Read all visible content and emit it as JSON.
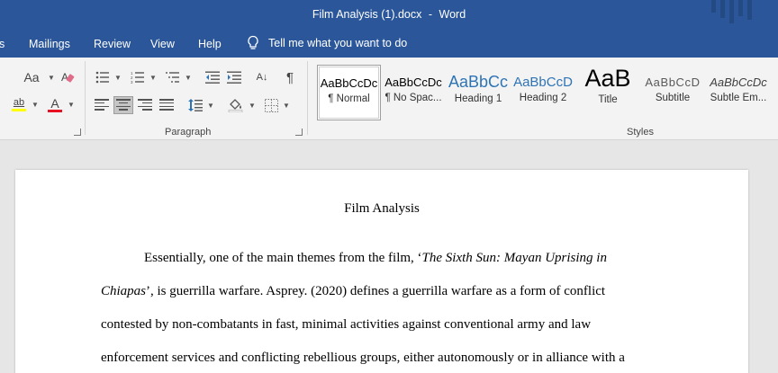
{
  "window": {
    "file_name": "Film Analysis (1).docx",
    "separator": "-",
    "app_name": "Word"
  },
  "menu": {
    "tabs": [
      "s",
      "Mailings",
      "Review",
      "View",
      "Help"
    ],
    "tell_me": "Tell me what you want to do"
  },
  "ribbon": {
    "font_group": {
      "font_size_glyph": "Aa",
      "highlight_glyph": "ab",
      "font_color_glyph": "A",
      "highlight_color": "#ffff00",
      "font_color": "#e81123"
    },
    "paragraph_group": {
      "label": "Paragraph",
      "sort_glyph": "A↓",
      "pilcrow_glyph": "¶"
    },
    "styles_group": {
      "label": "Styles",
      "items": [
        {
          "sample": "AaBbCcDc",
          "name": "¶ Normal"
        },
        {
          "sample": "AaBbCcDc",
          "name": "¶ No Spac..."
        },
        {
          "sample": "AaBbCc",
          "name": "Heading 1"
        },
        {
          "sample": "AaBbCcD",
          "name": "Heading 2"
        },
        {
          "sample": "AaB",
          "name": "Title"
        },
        {
          "sample": "AaBbCcD",
          "name": "Subtitle"
        },
        {
          "sample": "AaBbCcDc",
          "name": "Subtle Em..."
        }
      ]
    }
  },
  "document": {
    "title": "Film Analysis",
    "paragraph": {
      "line1_before": "Essentially, one of the main themes from the film, ‘",
      "line1_italic": "The Sixth Sun: Mayan Uprising in",
      "line2_italic": "Chiapas",
      "line2_after": "’, is guerrilla warfare. Asprey. (2020) defines a guerrilla warfare as a form of conflict",
      "line3": "contested by non-combatants in fast, minimal activities against conventional army and law",
      "line4": "enforcement services and conflicting rebellious groups, either autonomously or in alliance with a"
    }
  },
  "colors": {
    "title_bar": "#2b579a",
    "heading_blue": "#2e74b5"
  }
}
